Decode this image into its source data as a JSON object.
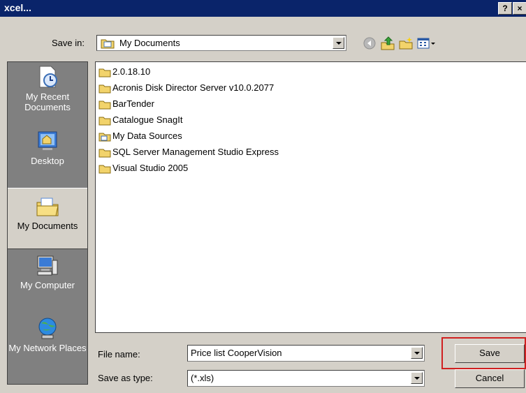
{
  "window": {
    "title": "xcel...",
    "help_button": "?",
    "close_button": "×"
  },
  "toolbar": {
    "save_in_label": "Save in:",
    "save_in_value": "My Documents",
    "icons": [
      "back-icon",
      "up-folder-icon",
      "new-folder-icon",
      "views-menu-icon"
    ]
  },
  "places": [
    {
      "label": "My Recent Documents",
      "icon": "recent-documents-icon"
    },
    {
      "label": "Desktop",
      "icon": "desktop-icon"
    },
    {
      "label": "My Documents",
      "icon": "my-documents-icon",
      "active": true
    },
    {
      "label": "My Computer",
      "icon": "my-computer-icon"
    },
    {
      "label": "My Network Places",
      "icon": "network-places-icon"
    }
  ],
  "files": [
    {
      "name": "2.0.18.10",
      "icon": "folder-icon"
    },
    {
      "name": "Acronis Disk Director Server v10.0.2077",
      "icon": "folder-icon"
    },
    {
      "name": "BarTender",
      "icon": "folder-icon"
    },
    {
      "name": "Catalogue SnagIt",
      "icon": "folder-icon"
    },
    {
      "name": "My Data Sources",
      "icon": "data-sources-folder-icon"
    },
    {
      "name": "SQL Server Management Studio Express",
      "icon": "folder-icon"
    },
    {
      "name": "Visual Studio 2005",
      "icon": "folder-icon"
    }
  ],
  "form": {
    "file_name_label": "File name:",
    "file_name_value": "Price list CooperVision",
    "save_as_type_label": "Save as type:",
    "save_as_type_value": "(*.xls)"
  },
  "buttons": {
    "save": "Save",
    "cancel": "Cancel"
  },
  "colors": {
    "titlebar": "#0a246a",
    "dialog_bg": "#d4d0c8",
    "places_bg": "#808080",
    "save_highlight": "#d02020",
    "folder": "#f2d36b"
  }
}
